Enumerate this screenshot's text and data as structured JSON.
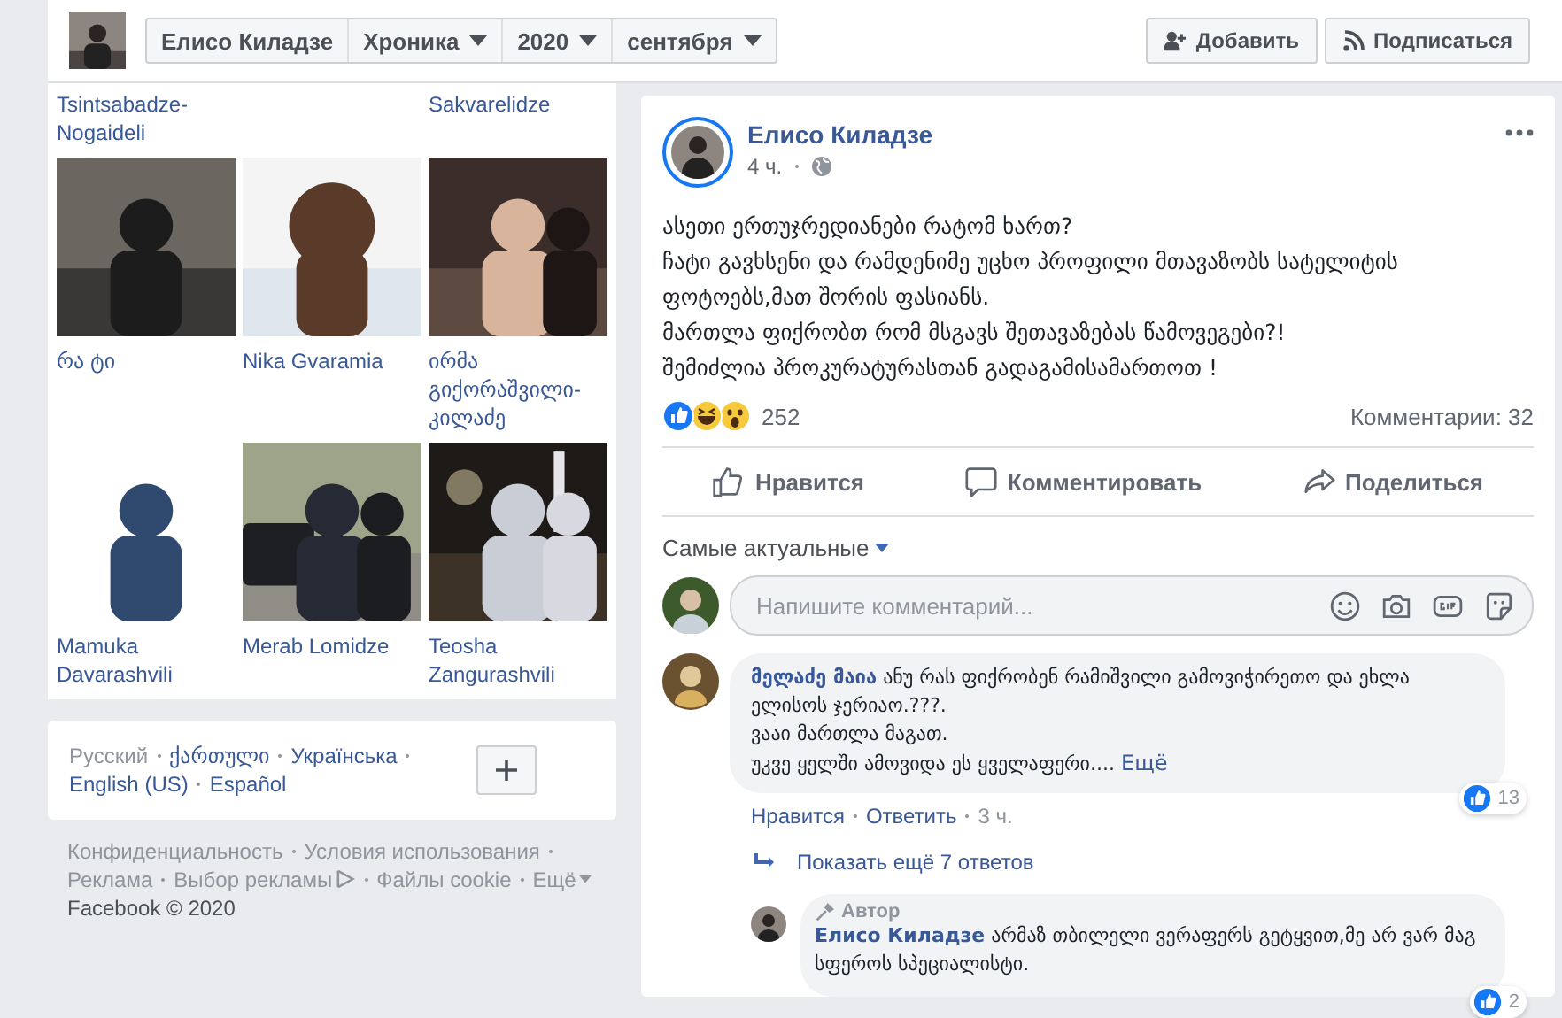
{
  "header": {
    "name": "Елисо Киладзе",
    "dropdowns": [
      {
        "label": "Хроника"
      },
      {
        "label": "2020"
      },
      {
        "label": "сентября"
      }
    ],
    "buttons": [
      {
        "label": "Добавить",
        "kind": "add"
      },
      {
        "label": "Подписаться",
        "kind": "follow"
      }
    ]
  },
  "friends_cut_row": [
    {
      "kind": "name",
      "name": "Tsintsabadze-Nogaideli"
    },
    {
      "kind": "blank"
    },
    {
      "kind": "name",
      "name": "Sakvarelidze"
    }
  ],
  "friends": [
    {
      "name": "რა ტი"
    },
    {
      "name": "Nika Gvaramia"
    },
    {
      "name": "ირმა გიქორაშვილი-კილაძე"
    },
    {
      "name": "Mamuka Davarashvili"
    },
    {
      "name": "Merab Lomidze"
    },
    {
      "name": "Teosha Zangurashvili"
    }
  ],
  "languages": [
    {
      "label": "Русский",
      "selected": true
    },
    {
      "label": "ქართული",
      "selected": false
    },
    {
      "label": "Українська",
      "selected": false
    },
    {
      "label": "English (US)",
      "selected": false
    },
    {
      "label": "Español",
      "selected": false
    }
  ],
  "footer_links": [
    "Конфиденциальность",
    "Условия использования",
    "Реклама",
    "Выбор рекламы",
    "Файлы cookie",
    "Ещё"
  ],
  "copyright": "Facebook © 2020",
  "post": {
    "author": "Елисо Киладзе",
    "time": "4 ч.",
    "lines": [
      "ასეთი ერთუჯრედიანები რატომ ხართ?",
      "ჩატი გავხსენი და რამდენიმე უცხო პროფილი მთავაზობს სატელიტის ფოტოებს,მათ შორის ფასიანს.",
      "მართლა ფიქრობთ რომ მსგავს შეთავაზებას წამოვეგები?!",
      "შემიძლია პროკურატურასთან გადაგამისამართოთ !"
    ],
    "reactions": [
      {
        "kind": "like"
      },
      {
        "kind": "haha"
      },
      {
        "kind": "wow"
      }
    ],
    "reaction_count": "252",
    "comment_count": "Комментарии: 32",
    "actions": [
      {
        "label": "Нравится",
        "kind": "like"
      },
      {
        "label": "Комментировать",
        "kind": "comment"
      },
      {
        "label": "Поделиться",
        "kind": "share"
      }
    ],
    "sort": "Самые актуальные",
    "composer": {
      "placeholder": "Напишите комментарий..."
    },
    "comment": {
      "author": "მელაძე მაია",
      "lines": [
        "ანუ რას ფიქრობენ რამიშვილი გამოვიჭირეთო და ეხლა ელისოს ჯერიაო.???.",
        "ვააი მართლა მაგათ.",
        "უკვე ყელში ამოვიდა ეს ყველაფერი...."
      ],
      "more": "Ещё",
      "likes": "13",
      "meta": [
        "Нравится",
        "Ответить",
        "3 ч."
      ]
    },
    "show_more": "Показать ещё 7 ответов",
    "reply": {
      "badge": "Автор",
      "author": "Елисо Киладзе",
      "text": "არმაზ თბილელი ვერაფერს გეტყვით,მე არ ვარ მაგ სფეროს სპეციალისტი.",
      "likes": "2"
    }
  }
}
